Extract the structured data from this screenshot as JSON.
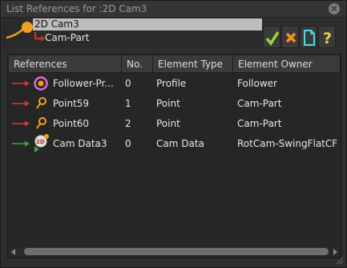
{
  "window": {
    "title": "List References for :2D Cam3"
  },
  "tree": {
    "root_label": "2D Cam3",
    "child_label": "Cam-Part"
  },
  "toolbar": {
    "ok_icon": "check-icon",
    "cancel_icon": "x-icon",
    "new_icon": "document-icon",
    "help_icon": "help-icon"
  },
  "columns": [
    "References",
    "No.",
    "Element Type",
    "Element Owner"
  ],
  "rows": [
    {
      "reference": "Follower-Pr...",
      "no": "0",
      "type": "Profile",
      "owner": "Follower",
      "icon": "profile-icon"
    },
    {
      "reference": "Point59",
      "no": "1",
      "type": "Point",
      "owner": "Cam-Part",
      "icon": "point-icon"
    },
    {
      "reference": "Point60",
      "no": "2",
      "type": "Point",
      "owner": "Cam-Part",
      "icon": "point-icon"
    },
    {
      "reference": "Cam Data3",
      "no": "0",
      "type": "Cam Data",
      "owner": "RotCam-SwingFlatCF",
      "icon": "cam-data-icon"
    }
  ],
  "colors": {
    "accent_orange": "#f0a020",
    "check_green": "#9bd43a",
    "cancel_orange": "#f29418",
    "doc_cyan": "#4fd9e6",
    "help_yellow": "#e2d844",
    "link_red": "#d83a2a",
    "link_green": "#3ca83c"
  }
}
